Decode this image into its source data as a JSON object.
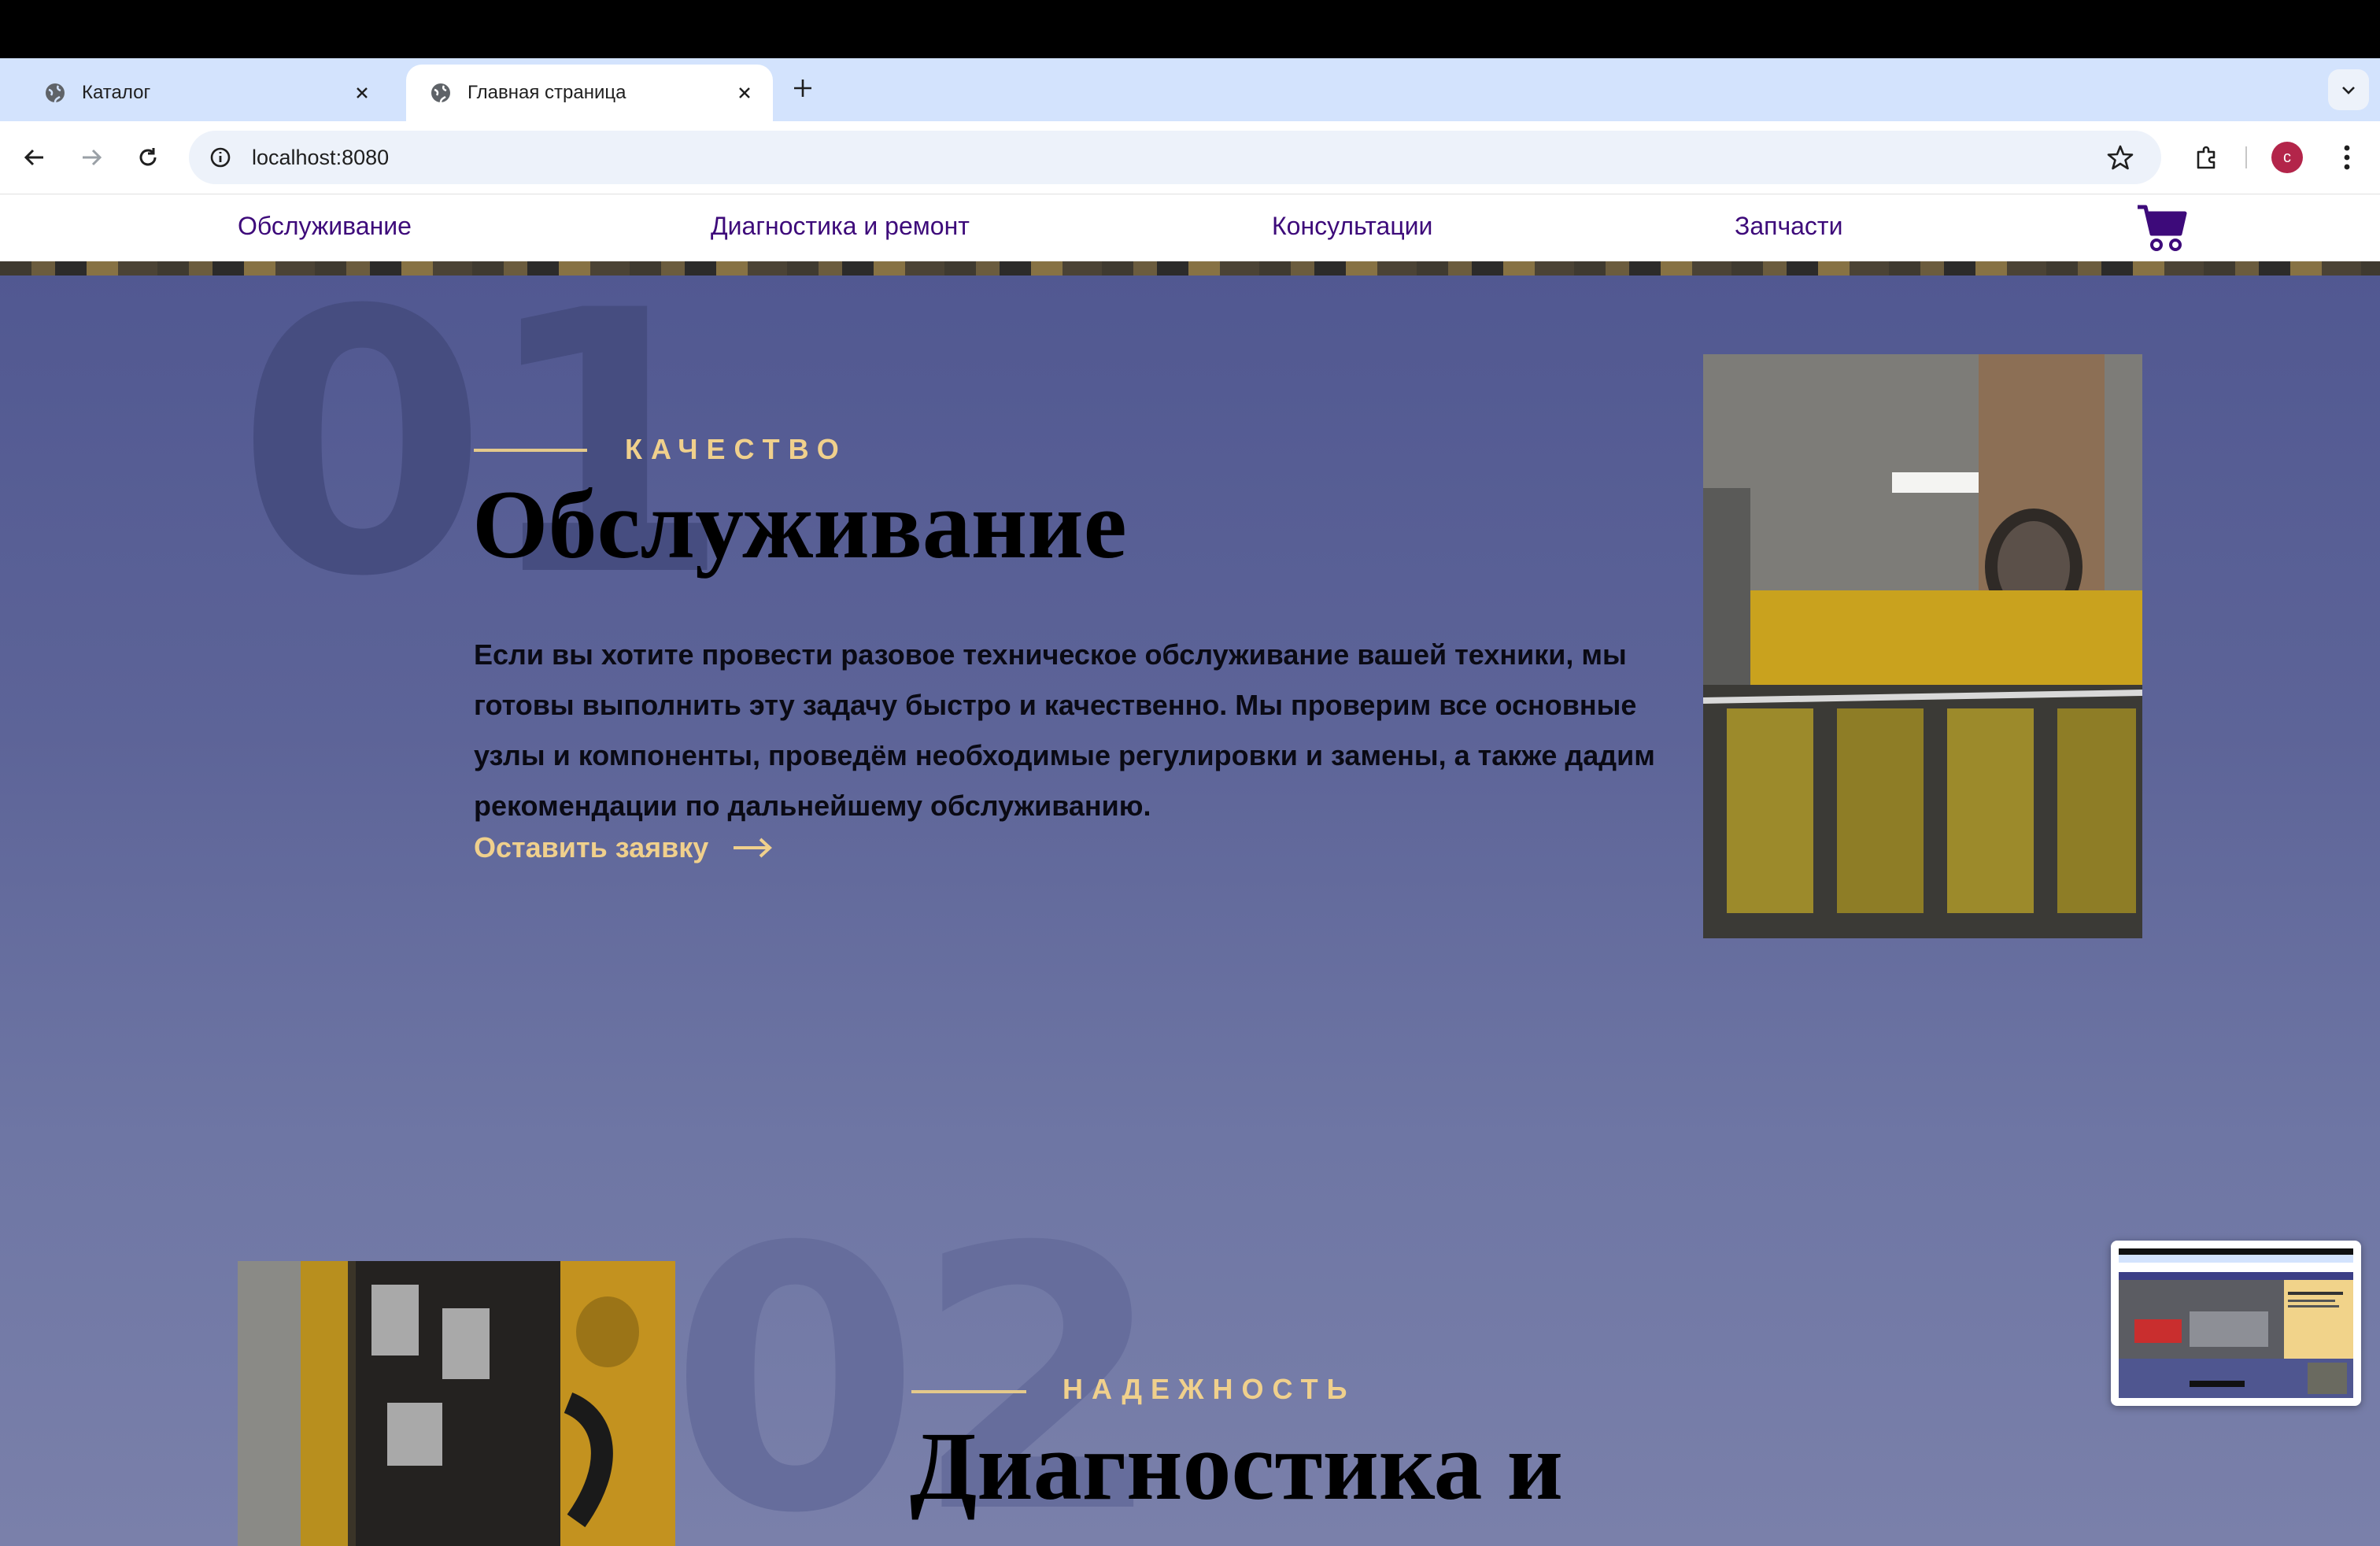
{
  "browser": {
    "tabs": [
      {
        "title": "Каталог",
        "active": false
      },
      {
        "title": "Главная страница",
        "active": true
      }
    ],
    "url": "localhost:8080",
    "profile_initial": "c"
  },
  "site_nav": {
    "links": [
      "Обслуживание",
      "Диагностика и ремонт",
      "Консультации",
      "Запчасти"
    ]
  },
  "sections": [
    {
      "number": "01",
      "eyebrow": "КАЧЕСТВО",
      "title": "Обслуживание",
      "description": "Если вы хотите провести разовое техническое обслуживание вашей техники, мы готовы выполнить эту задачу быстро и качественно. Мы проверим все основные узлы и компоненты, проведём необходимые регулировки и замены, а также дадим рекомендации по дальнейшему обслуживанию.",
      "cta": "Оставить заявку"
    },
    {
      "number": "02",
      "eyebrow": "НАДЕЖНОСТЬ",
      "title": "Диагностика и"
    }
  ],
  "colors": {
    "nav_link": "#3d0a7a",
    "accent_gold": "#f0d08c",
    "section_bg_top": "#4f5690",
    "section_bg_bottom": "#7a80aa",
    "tab_strip": "#d3e3fd",
    "avatar": "#b3254a"
  }
}
